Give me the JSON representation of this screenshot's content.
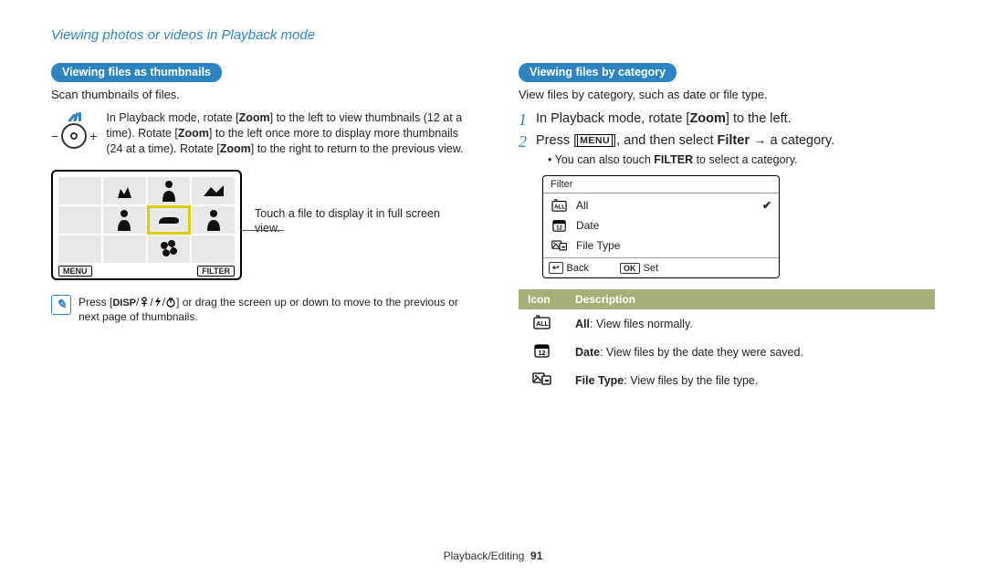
{
  "chapter_title": "Viewing photos or videos in Playback mode",
  "left": {
    "section_label": "Viewing files as thumbnails",
    "intro": "Scan thumbnails of files.",
    "zoom_instruction": {
      "pre1": "In Playback mode, rotate [",
      "zoom1": "Zoom",
      "mid1": "] to the left to view thumbnails (12 at a time). Rotate [",
      "zoom2": "Zoom",
      "mid2": "] to the left once more to display more thumbnails (24 at a time). Rotate [",
      "zoom3": "Zoom",
      "post": "] to the right to return to the previous view."
    },
    "screen_menu": "MENU",
    "screen_filter": "FILTER",
    "callout": "Touch a file to display it in full screen view.",
    "note": {
      "pre": "Press [",
      "disp": "DISP",
      "mid": "] or drag the screen up or down to move to the previous or next page of thumbnails."
    }
  },
  "right": {
    "section_label": "Viewing files by category",
    "intro": "View files by category, such as date or file type.",
    "steps": [
      {
        "num": "1",
        "pre": "In Playback mode, rotate [",
        "zoom": "Zoom",
        "post": "] to the left."
      },
      {
        "num": "2",
        "pre": "Press [",
        "menu_key": "MENU",
        "mid": "], and then select ",
        "filter": "Filter",
        "arrow": " → ",
        "post": "a category."
      }
    ],
    "sub_bullet": {
      "pre": "You can also touch ",
      "filter": "FILTER",
      "post": " to select a category."
    },
    "menu": {
      "title": "Filter",
      "items": [
        {
          "label": "All",
          "selected": true
        },
        {
          "label": "Date",
          "selected": false
        },
        {
          "label": "File Type",
          "selected": false
        }
      ],
      "back_label": "Back",
      "ok_key": "OK",
      "set_label": "Set"
    },
    "table": {
      "header_icon": "Icon",
      "header_desc": "Description",
      "rows": [
        {
          "name": "All",
          "desc": ": View files normally."
        },
        {
          "name": "Date",
          "desc": ": View files by the date they were saved."
        },
        {
          "name": "File Type",
          "desc": ": View files by the file type."
        }
      ]
    }
  },
  "footer": {
    "section": "Playback/Editing",
    "page": "91"
  }
}
